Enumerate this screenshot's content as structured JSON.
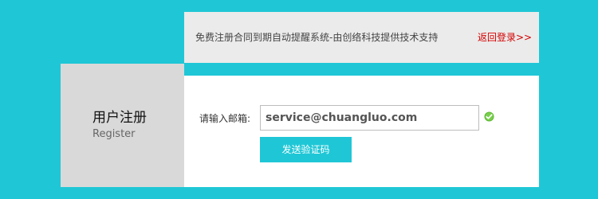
{
  "notice": {
    "text": "免费注册合同到期自动提醒系统-由创络科技提供技术支持",
    "back_login_label": "返回登录>>"
  },
  "sidebar": {
    "title": "用户注册",
    "subtitle": "Register"
  },
  "form": {
    "email_label": "请输入邮箱:",
    "email_value": "service@chuangluo.com",
    "send_code_button": "发送验证码",
    "status_icon": "check-circle-icon"
  },
  "colors": {
    "background": "#1fc7d6",
    "notice_bg": "#ebebeb",
    "sidebar_bg": "#d9d9d9",
    "link": "#d50000",
    "button": "#1fc7d6",
    "check": "#5bb830"
  }
}
